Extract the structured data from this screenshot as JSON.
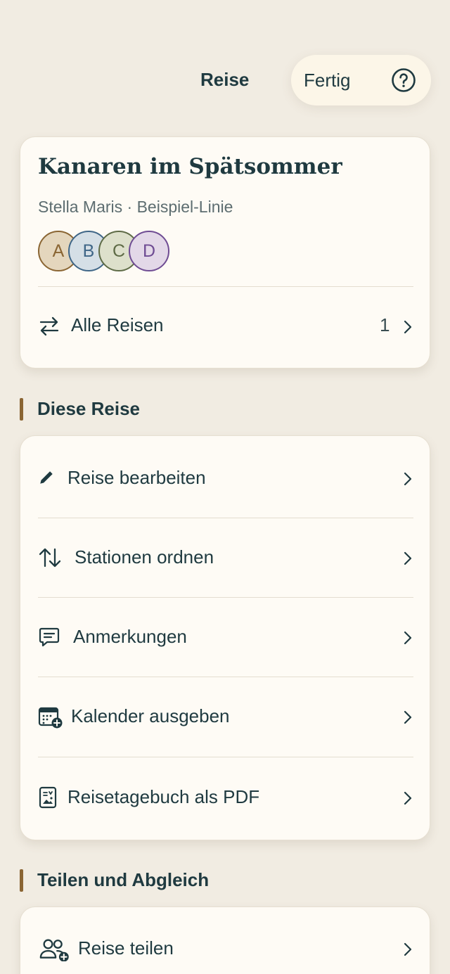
{
  "header": {
    "title": "Reise",
    "done_label": "Fertig",
    "help_icon": "help-circle-icon"
  },
  "trip": {
    "name": "Kanaren im Spätsommer",
    "subtitle": "Stella Maris · Beispiel-Linie",
    "participants": [
      {
        "initial": "A",
        "bg": "#e4d6bd",
        "border": "#8a6533",
        "text": "#8a6533"
      },
      {
        "initial": "B",
        "bg": "#d5dfe6",
        "border": "#3f6687",
        "text": "#3f6687"
      },
      {
        "initial": "C",
        "bg": "#dde0cb",
        "border": "#5e6b46",
        "text": "#5e6b46"
      },
      {
        "initial": "D",
        "bg": "#e3d8e8",
        "border": "#6f4c93",
        "text": "#6f4c93"
      }
    ],
    "all_trips_label": "Alle Reisen",
    "all_trips_count": "1"
  },
  "sections": {
    "this_trip": {
      "title": "Diese Reise",
      "items": [
        {
          "label": "Reise bearbeiten",
          "icon": "pencil-icon"
        },
        {
          "label": "Stationen ordnen",
          "icon": "sort-arrows-icon"
        },
        {
          "label": "Anmerkungen",
          "icon": "comment-icon"
        },
        {
          "label": "Kalender ausgeben",
          "icon": "calendar-add-icon"
        },
        {
          "label": "Reisetagebuch als PDF",
          "icon": "document-image-icon"
        }
      ]
    },
    "sharing": {
      "title": "Teilen und Abgleich",
      "items": [
        {
          "label": "Reise teilen",
          "icon": "users-add-icon"
        }
      ]
    }
  },
  "colors": {
    "background": "#f1ece2",
    "card": "#fefbf5",
    "text": "#1f3a40",
    "accent_bar": "#8a6533"
  }
}
